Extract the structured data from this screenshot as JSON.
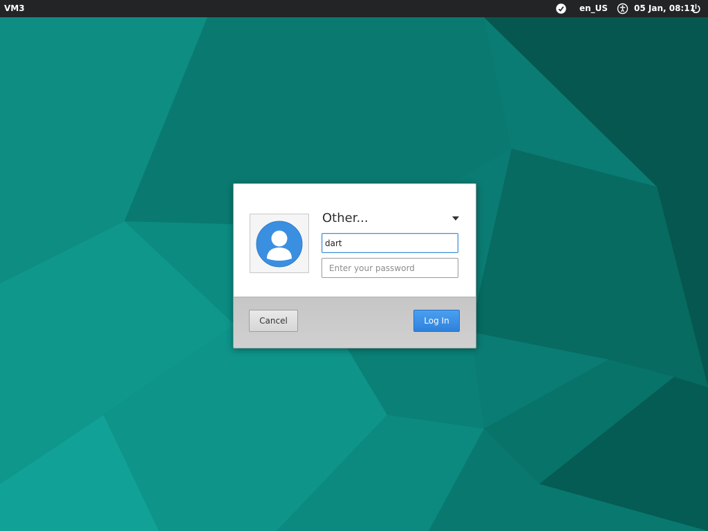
{
  "topbar": {
    "hostname": "VM3",
    "keyboard_layout": "en_US",
    "datetime": "05 Jan, 08:11",
    "icons": {
      "notification": "notification-icon",
      "accessibility": "accessibility-icon",
      "power": "power-icon"
    }
  },
  "login": {
    "user_selector": "Other...",
    "username_value": "dart",
    "password_placeholder": "Enter your password",
    "avatar_icon": "user-avatar-icon",
    "cancel_label": "Cancel",
    "login_label": "Log In"
  },
  "colors": {
    "wallpaper_base": "#0c7f76",
    "topbar": "#222426",
    "login_button": "#3a8ee6"
  }
}
